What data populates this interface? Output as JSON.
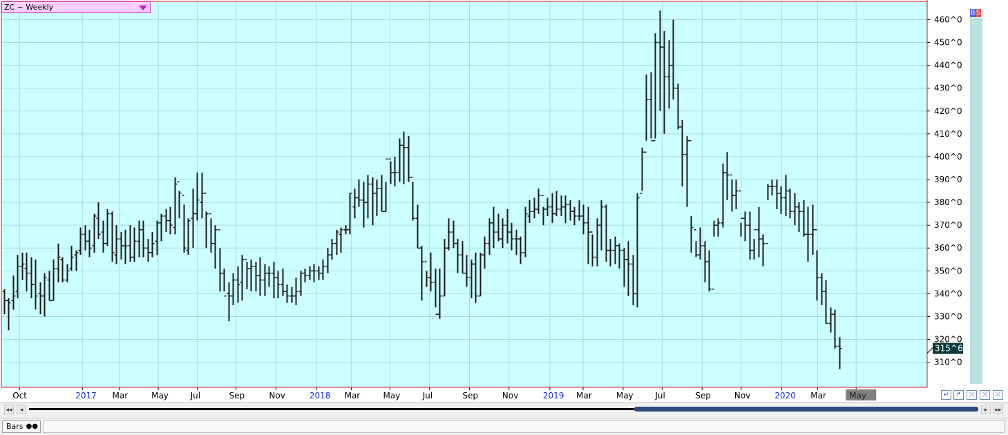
{
  "symbol": {
    "label": "ZC ~ Weekly"
  },
  "trade_buttons": {
    "buy": "B",
    "sell": "S"
  },
  "footer": {
    "chart_style": "Bars"
  },
  "colors": {
    "plot_bg": "#ccffff",
    "grid": "#a8dcdc",
    "bars": "#1a1a1a",
    "border": "#e01010",
    "year_label": "#1030d0",
    "last_price_bg": "#0c3a3a",
    "month_highlight_bg": "#808080"
  },
  "chart_data": {
    "type": "bar",
    "subtype": "ohlc",
    "title": "ZC ~ Weekly",
    "frequency": "weekly",
    "ylim": [
      299,
      468
    ],
    "y_ticks": [
      {
        "v": 310,
        "label": "310^0"
      },
      {
        "v": 320,
        "label": "320^0"
      },
      {
        "v": 330,
        "label": "330^0"
      },
      {
        "v": 340,
        "label": "340^0"
      },
      {
        "v": 350,
        "label": "350^0"
      },
      {
        "v": 360,
        "label": "360^0"
      },
      {
        "v": 370,
        "label": "370^0"
      },
      {
        "v": 380,
        "label": "380^0"
      },
      {
        "v": 390,
        "label": "390^0"
      },
      {
        "v": 400,
        "label": "400^0"
      },
      {
        "v": 410,
        "label": "410^0"
      },
      {
        "v": 420,
        "label": "420^0"
      },
      {
        "v": 430,
        "label": "430^0"
      },
      {
        "v": 440,
        "label": "440^0"
      },
      {
        "v": 450,
        "label": "450^0"
      },
      {
        "v": 460,
        "label": "460^0"
      }
    ],
    "last_price": {
      "value": 315.75,
      "label": "315^6"
    },
    "x_labels": [
      {
        "i": 3.5,
        "label": "Oct",
        "year": false
      },
      {
        "i": 17.5,
        "label": "2017",
        "year": true
      },
      {
        "i": 25.7,
        "label": "Mar",
        "year": false
      },
      {
        "i": 34.4,
        "label": "May",
        "year": false
      },
      {
        "i": 43.1,
        "label": "Jul",
        "year": false
      },
      {
        "i": 51.7,
        "label": "Sep",
        "year": false
      },
      {
        "i": 60.6,
        "label": "Nov",
        "year": false
      },
      {
        "i": 69.6,
        "label": "2018",
        "year": true
      },
      {
        "i": 77.4,
        "label": "Mar",
        "year": false
      },
      {
        "i": 86.0,
        "label": "May",
        "year": false
      },
      {
        "i": 94.8,
        "label": "Jul",
        "year": false
      },
      {
        "i": 103.7,
        "label": "Sep",
        "year": false
      },
      {
        "i": 112.5,
        "label": "Nov",
        "year": false
      },
      {
        "i": 121.6,
        "label": "2019",
        "year": true
      },
      {
        "i": 129.0,
        "label": "Mar",
        "year": false
      },
      {
        "i": 137.9,
        "label": "May",
        "year": false
      },
      {
        "i": 146.6,
        "label": "Jul",
        "year": false
      },
      {
        "i": 155.5,
        "label": "Sep",
        "year": false
      },
      {
        "i": 164.2,
        "label": "Nov",
        "year": false
      },
      {
        "i": 173.2,
        "label": "2020",
        "year": true
      },
      {
        "i": 181.2,
        "label": "Mar",
        "year": false
      },
      {
        "i": 189.8,
        "label": "May",
        "year": false,
        "highlight": true
      }
    ],
    "ohlc": [
      [
        341,
        342,
        331,
        337
      ],
      [
        337,
        338,
        324,
        336
      ],
      [
        337,
        348,
        333,
        339
      ],
      [
        341,
        357,
        338,
        352
      ],
      [
        352,
        358,
        346,
        353
      ],
      [
        351,
        358,
        341,
        349
      ],
      [
        349,
        356,
        338,
        344
      ],
      [
        344,
        355,
        333,
        339
      ],
      [
        340,
        345,
        331,
        339
      ],
      [
        339,
        349,
        330,
        347
      ],
      [
        346,
        350,
        337,
        337
      ],
      [
        337,
        355,
        337,
        351
      ],
      [
        351,
        362,
        345,
        356
      ],
      [
        355,
        356,
        345,
        346
      ],
      [
        346,
        353,
        345,
        350
      ],
      [
        351,
        361,
        350,
        356
      ],
      [
        357,
        359,
        350,
        358
      ],
      [
        359,
        369,
        357,
        366
      ],
      [
        366,
        370,
        359,
        363
      ],
      [
        363,
        368,
        356,
        360
      ],
      [
        361,
        375,
        358,
        374
      ],
      [
        373,
        380,
        364,
        366
      ],
      [
        367,
        372,
        358,
        362
      ],
      [
        362,
        377,
        361,
        375
      ],
      [
        375,
        376,
        354,
        358
      ],
      [
        357,
        370,
        353,
        364
      ],
      [
        364,
        367,
        355,
        361
      ],
      [
        361,
        368,
        353,
        361
      ],
      [
        361,
        370,
        354,
        356
      ],
      [
        356,
        369,
        354,
        363
      ],
      [
        363,
        372,
        356,
        368
      ],
      [
        368,
        372,
        356,
        360
      ],
      [
        360,
        364,
        354,
        358
      ],
      [
        358,
        367,
        356,
        362
      ],
      [
        363,
        372,
        357,
        371
      ],
      [
        371,
        375,
        363,
        374
      ],
      [
        374,
        377,
        367,
        372
      ],
      [
        372,
        378,
        366,
        370
      ],
      [
        369,
        391,
        366,
        388
      ],
      [
        389,
        385,
        373,
        384
      ],
      [
        383,
        379,
        358,
        360
      ],
      [
        359,
        373,
        357,
        372
      ],
      [
        373,
        386,
        360,
        375
      ],
      [
        375,
        393,
        372,
        381
      ],
      [
        380,
        393,
        373,
        384
      ],
      [
        384,
        376,
        360,
        375
      ],
      [
        375,
        373,
        358,
        362
      ],
      [
        362,
        370,
        351,
        368
      ],
      [
        368,
        360,
        341,
        349
      ],
      [
        349,
        351,
        341,
        339
      ],
      [
        340,
        345,
        328,
        339
      ],
      [
        339,
        349,
        335,
        346
      ],
      [
        346,
        352,
        336,
        344
      ],
      [
        345,
        357,
        337,
        355
      ],
      [
        355,
        354,
        342,
        351
      ],
      [
        351,
        355,
        341,
        352
      ],
      [
        352,
        354,
        341,
        348
      ],
      [
        348,
        356,
        339,
        346
      ],
      [
        346,
        353,
        339,
        349
      ],
      [
        349,
        352,
        343,
        349
      ],
      [
        349,
        354,
        338,
        347
      ],
      [
        347,
        350,
        338,
        344
      ],
      [
        344,
        351,
        339,
        341
      ],
      [
        341,
        344,
        336,
        339
      ],
      [
        339,
        343,
        336,
        339
      ],
      [
        339,
        347,
        335,
        341
      ],
      [
        341,
        350,
        339,
        349
      ],
      [
        349,
        351,
        345,
        348
      ],
      [
        348,
        352,
        346,
        350
      ],
      [
        350,
        353,
        345,
        350
      ],
      [
        350,
        352,
        346,
        349
      ],
      [
        349,
        355,
        346,
        352
      ],
      [
        352,
        360,
        349,
        357
      ],
      [
        357,
        364,
        355,
        362
      ],
      [
        362,
        368,
        357,
        367
      ],
      [
        366,
        369,
        358,
        368
      ],
      [
        368,
        370,
        366,
        368
      ],
      [
        368,
        384,
        366,
        384
      ],
      [
        378,
        386,
        373,
        382
      ],
      [
        382,
        390,
        378,
        381
      ],
      [
        381,
        389,
        369,
        380
      ],
      [
        380,
        392,
        373,
        388
      ],
      [
        388,
        391,
        370,
        384
      ],
      [
        384,
        390,
        374,
        386
      ],
      [
        386,
        392,
        376,
        376
      ],
      [
        376,
        389,
        376,
        399
      ],
      [
        399,
        398,
        388,
        393
      ],
      [
        393,
        400,
        387,
        393
      ],
      [
        393,
        408,
        389,
        405
      ],
      [
        405,
        411,
        388,
        404
      ],
      [
        404,
        409,
        389,
        391
      ],
      [
        391,
        389,
        372,
        373
      ],
      [
        373,
        379,
        360,
        360
      ],
      [
        360,
        361,
        337,
        354
      ],
      [
        354,
        350,
        343,
        347
      ],
      [
        347,
        358,
        341,
        345
      ],
      [
        345,
        351,
        334,
        331
      ],
      [
        331,
        351,
        329,
        339
      ],
      [
        339,
        364,
        339,
        360
      ],
      [
        360,
        373,
        359,
        367
      ],
      [
        367,
        372,
        360,
        362
      ],
      [
        362,
        364,
        349,
        357
      ],
      [
        357,
        363,
        349,
        349
      ],
      [
        349,
        357,
        343,
        347
      ],
      [
        347,
        355,
        338,
        353
      ],
      [
        353,
        358,
        336,
        339
      ],
      [
        339,
        358,
        339,
        357
      ],
      [
        357,
        365,
        351,
        362
      ],
      [
        362,
        373,
        357,
        371
      ],
      [
        371,
        378,
        360,
        367
      ],
      [
        367,
        375,
        363,
        364
      ],
      [
        364,
        373,
        360,
        370
      ],
      [
        370,
        377,
        362,
        367
      ],
      [
        367,
        371,
        359,
        364
      ],
      [
        364,
        368,
        357,
        364
      ],
      [
        364,
        365,
        353,
        358
      ],
      [
        358,
        378,
        356,
        375
      ],
      [
        374,
        381,
        371,
        376
      ],
      [
        376,
        382,
        373,
        377
      ],
      [
        377,
        386,
        375,
        383
      ],
      [
        383,
        378,
        370,
        377
      ],
      [
        377,
        382,
        374,
        378
      ],
      [
        378,
        384,
        371,
        375
      ],
      [
        375,
        385,
        374,
        377
      ],
      [
        377,
        383,
        374,
        378
      ],
      [
        378,
        383,
        371,
        379
      ],
      [
        379,
        381,
        372,
        376
      ],
      [
        376,
        378,
        370,
        374
      ],
      [
        374,
        381,
        372,
        374
      ],
      [
        374,
        379,
        366,
        371
      ],
      [
        371,
        378,
        353,
        367
      ],
      [
        367,
        366,
        352,
        356
      ],
      [
        356,
        373,
        352,
        370
      ],
      [
        370,
        381,
        359,
        378
      ],
      [
        378,
        379,
        354,
        359
      ],
      [
        359,
        364,
        352,
        359
      ],
      [
        359,
        365,
        353,
        361
      ],
      [
        361,
        362,
        351,
        359
      ],
      [
        359,
        360,
        343,
        355
      ],
      [
        355,
        363,
        339,
        353
      ],
      [
        353,
        357,
        335,
        340
      ],
      [
        340,
        384,
        334,
        382
      ],
      [
        384,
        404,
        385,
        402
      ],
      [
        402,
        436,
        407,
        425
      ],
      [
        425,
        437,
        408,
        407
      ],
      [
        407,
        454,
        408,
        450
      ],
      [
        450,
        464,
        420,
        448
      ],
      [
        448,
        455,
        410,
        435
      ],
      [
        435,
        451,
        421,
        440
      ],
      [
        440,
        460,
        425,
        430
      ],
      [
        430,
        432,
        412,
        413
      ],
      [
        413,
        416,
        387,
        401
      ],
      [
        401,
        409,
        378,
        407
      ],
      [
        407,
        374,
        358,
        369
      ],
      [
        368,
        363,
        356,
        357
      ],
      [
        357,
        369,
        355,
        361
      ],
      [
        361,
        363,
        345,
        354
      ],
      [
        354,
        359,
        341,
        342
      ],
      [
        342,
        372,
        365,
        370
      ],
      [
        370,
        373,
        365,
        371
      ],
      [
        371,
        397,
        369,
        393
      ],
      [
        393,
        402,
        381,
        392
      ],
      [
        392,
        390,
        376,
        383
      ],
      [
        383,
        390,
        377,
        385
      ],
      [
        385,
        371,
        365,
        373
      ],
      [
        373,
        376,
        363,
        370
      ],
      [
        370,
        376,
        355,
        359
      ],
      [
        359,
        364,
        355,
        368
      ],
      [
        368,
        378,
        356,
        364
      ],
      [
        364,
        366,
        352,
        362
      ],
      [
        362,
        388,
        381,
        387
      ],
      [
        387,
        390,
        383,
        387
      ],
      [
        387,
        390,
        377,
        384
      ],
      [
        384,
        387,
        375,
        382
      ],
      [
        382,
        392,
        374,
        385
      ],
      [
        385,
        386,
        373,
        376
      ],
      [
        376,
        384,
        370,
        378
      ],
      [
        378,
        380,
        367,
        376
      ],
      [
        376,
        381,
        365,
        366
      ],
      [
        366,
        378,
        354,
        366
      ],
      [
        366,
        379,
        357,
        368
      ],
      [
        368,
        359,
        337,
        347
      ],
      [
        347,
        349,
        335,
        341
      ],
      [
        341,
        346,
        327,
        327
      ],
      [
        327,
        334,
        323,
        331
      ],
      [
        331,
        333,
        316,
        317
      ],
      [
        317,
        321,
        307,
        316
      ]
    ]
  }
}
